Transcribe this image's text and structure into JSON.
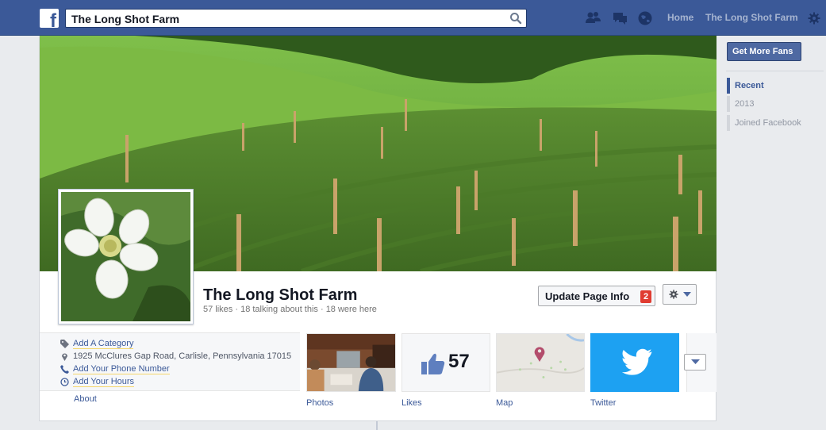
{
  "topbar": {
    "search_value": "The Long Shot Farm",
    "nav": {
      "home": "Home",
      "page": "The Long Shot Farm"
    },
    "icons": [
      "friend-requests-icon",
      "messages-icon",
      "notifications-icon",
      "settings-gear-icon"
    ]
  },
  "page": {
    "name": "The Long Shot Farm",
    "stats": "57 likes · 18 talking about this · 18 were here",
    "update_button": "Update Page Info",
    "update_badge": "2"
  },
  "about": {
    "rows": [
      {
        "icon": "tag-icon",
        "text": "Add A Category",
        "is_link": true
      },
      {
        "icon": "map-pin-icon",
        "text": "1925 McClures Gap Road, Carlisle, Pennsylvania 17015",
        "is_link": false
      },
      {
        "icon": "phone-icon",
        "text": "Add Your Phone Number",
        "is_link": true
      },
      {
        "icon": "clock-icon",
        "text": "Add Your Hours",
        "is_link": true
      }
    ],
    "label": "About"
  },
  "apps": {
    "photos_label": "Photos",
    "likes_label": "Likes",
    "likes_count": "57",
    "map_label": "Map",
    "twitter_label": "Twitter"
  },
  "right_rail": {
    "get_fans": "Get More Fans",
    "timeline": [
      {
        "label": "Recent",
        "active": true
      },
      {
        "label": "2013",
        "active": false
      },
      {
        "label": "Joined Facebook",
        "active": false
      }
    ]
  },
  "colors": {
    "brand_blue": "#3b5998",
    "twitter_blue": "#1da1f2",
    "badge_red": "#e03c31"
  }
}
